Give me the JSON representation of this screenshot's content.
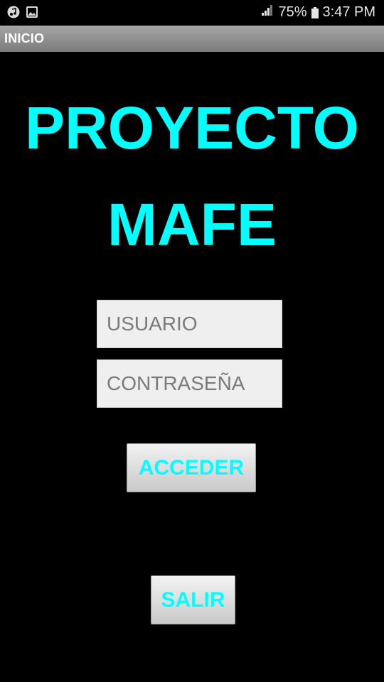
{
  "status_bar": {
    "icons_left": [
      "music-note-icon",
      "image-icon"
    ],
    "signal_icon": "signal-icon",
    "battery_percent": "75%",
    "battery_icon": "battery-icon",
    "time": "3:47 PM"
  },
  "action_bar": {
    "title": "INICIO",
    "background": "#8f8f8f"
  },
  "main": {
    "title_line1": "PROYECTO",
    "title_line2": "MAFE",
    "accent_color": "#00ffff",
    "username": {
      "value": "",
      "placeholder": "USUARIO"
    },
    "password": {
      "value": "",
      "placeholder": "CONTRASEÑA"
    },
    "access_button_label": "ACCEDER",
    "exit_button_label": "SALIR"
  }
}
